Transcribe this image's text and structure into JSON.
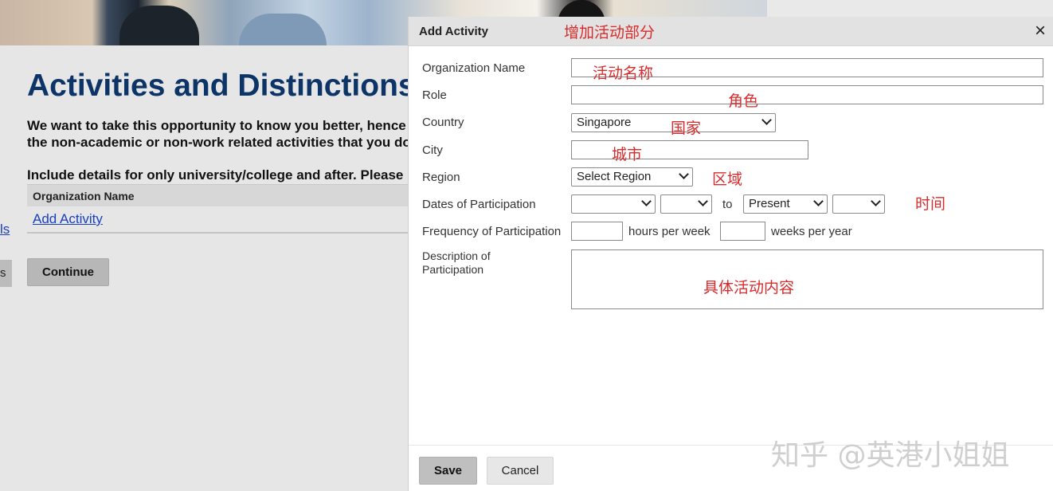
{
  "page": {
    "title": "Activities and Distinctions",
    "intro_line1": "We want to take this opportunity to know you better, hence",
    "intro_line2": "the non-academic or non-work related activities that you do",
    "include_text": "Include details for only university/college and after. Please",
    "table_header": "Organization Name",
    "add_activity_link": "Add Activity",
    "edge_link_text": "ls",
    "edge_button_text": "s",
    "continue_label": "Continue"
  },
  "modal": {
    "title": "Add Activity",
    "close_symbol": "×",
    "labels": {
      "organization_name": "Organization Name",
      "role": "Role",
      "country": "Country",
      "city": "City",
      "region": "Region",
      "dates": "Dates of Participation",
      "frequency": "Frequency of Participation",
      "description_line1": "Description of",
      "description_line2": "Participation"
    },
    "values": {
      "country": "Singapore",
      "region": "Select Region",
      "to_text": "to",
      "end_month": "Present",
      "hours_suffix": "hours per week",
      "weeks_suffix": "weeks per year"
    },
    "save_label": "Save",
    "cancel_label": "Cancel"
  },
  "annotations": {
    "header": "增加活动部分",
    "organization_name": "活动名称",
    "role": "角色",
    "country": "国家",
    "city": "城市",
    "region": "区域",
    "dates": "时间",
    "description": "具体活动内容"
  },
  "watermark": "知乎 @英港小姐姐",
  "colors": {
    "title_blue": "#0d3466",
    "link_blue": "#1a3fbf",
    "annotation_red": "#d92b2b"
  }
}
